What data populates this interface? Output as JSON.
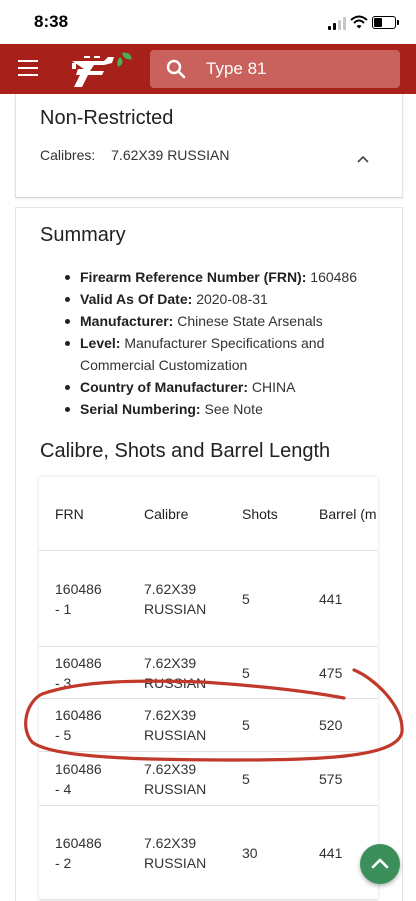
{
  "status_bar": {
    "time": "8:38"
  },
  "app_bar": {
    "search": {
      "placeholder": "Type 81"
    },
    "colors": {
      "bar": "#a8201a",
      "search_bg": "#c9615c",
      "logo_leaf": "#4caf50"
    }
  },
  "classification": {
    "heading": "Non-Restricted",
    "calibres_label": "Calibres:",
    "calibres_value": "7.62X39 RUSSIAN"
  },
  "summary": {
    "heading": "Summary",
    "items": [
      {
        "label": "Firearm Reference Number (FRN):",
        "value": "160486"
      },
      {
        "label": "Valid As Of Date:",
        "value": "2020-08-31"
      },
      {
        "label": "Manufacturer:",
        "value": "Chinese State Arsenals"
      },
      {
        "label": "Level:",
        "value": "Manufacturer Specifications and Commercial Customization"
      },
      {
        "label": "Country of Manufacturer:",
        "value": "CHINA"
      },
      {
        "label": "Serial Numbering:",
        "value": "See Note"
      }
    ]
  },
  "calibre_table": {
    "heading": "Calibre, Shots and Barrel Length",
    "columns": [
      "FRN",
      "Calibre",
      "Shots",
      "Barrel (m"
    ],
    "rows": [
      {
        "frn_a": "160486",
        "frn_b": "- 1",
        "cal_a": "7.62X39",
        "cal_b": "RUSSIAN",
        "shots": "5",
        "barrel": "441"
      },
      {
        "frn_a": "160486",
        "frn_b": "- 3",
        "cal_a": "7.62X39",
        "cal_b": "RUSSIAN",
        "shots": "5",
        "barrel": "475"
      },
      {
        "frn_a": "160486",
        "frn_b": "- 5",
        "cal_a": "7.62X39",
        "cal_b": "RUSSIAN",
        "shots": "5",
        "barrel": "520"
      },
      {
        "frn_a": "160486",
        "frn_b": "- 4",
        "cal_a": "7.62X39",
        "cal_b": "RUSSIAN",
        "shots": "5",
        "barrel": "575"
      },
      {
        "frn_a": "160486",
        "frn_b": "- 2",
        "cal_a": "7.62X39",
        "cal_b": "RUSSIAN",
        "shots": "30",
        "barrel": "441"
      }
    ]
  },
  "annotation": {
    "color": "#c0392b",
    "circled_row": "160486 - 5"
  },
  "fab": {
    "icon": "chevron-up-icon",
    "color": "#3b8f5a"
  }
}
